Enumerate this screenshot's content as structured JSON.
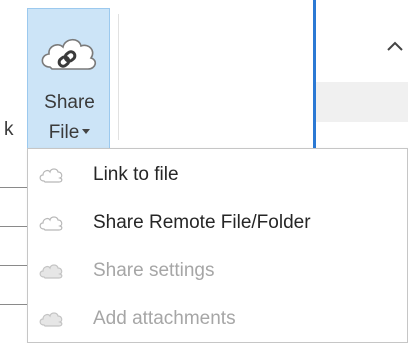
{
  "ribbon": {
    "left_fragment": "k",
    "share_file_button": {
      "label_line1": "Share",
      "label_line2": "File",
      "icon": "cloud-share-icon"
    },
    "collapse_icon": "chevron-up-icon"
  },
  "menu": {
    "items": [
      {
        "label": "Link to file",
        "icon": "cloud-icon",
        "enabled": true
      },
      {
        "label": "Share Remote File/Folder",
        "icon": "cloud-icon",
        "enabled": true
      },
      {
        "label": "Share settings",
        "icon": "cloud-icon",
        "enabled": false
      },
      {
        "label": "Add attachments",
        "icon": "cloud-icon",
        "enabled": false
      }
    ]
  },
  "colors": {
    "selected_bg": "#cce4f7",
    "selected_border": "#9cc9ee",
    "accent_blue": "#2b79d4",
    "text": "#262626",
    "disabled_text": "#a6a6a6"
  }
}
